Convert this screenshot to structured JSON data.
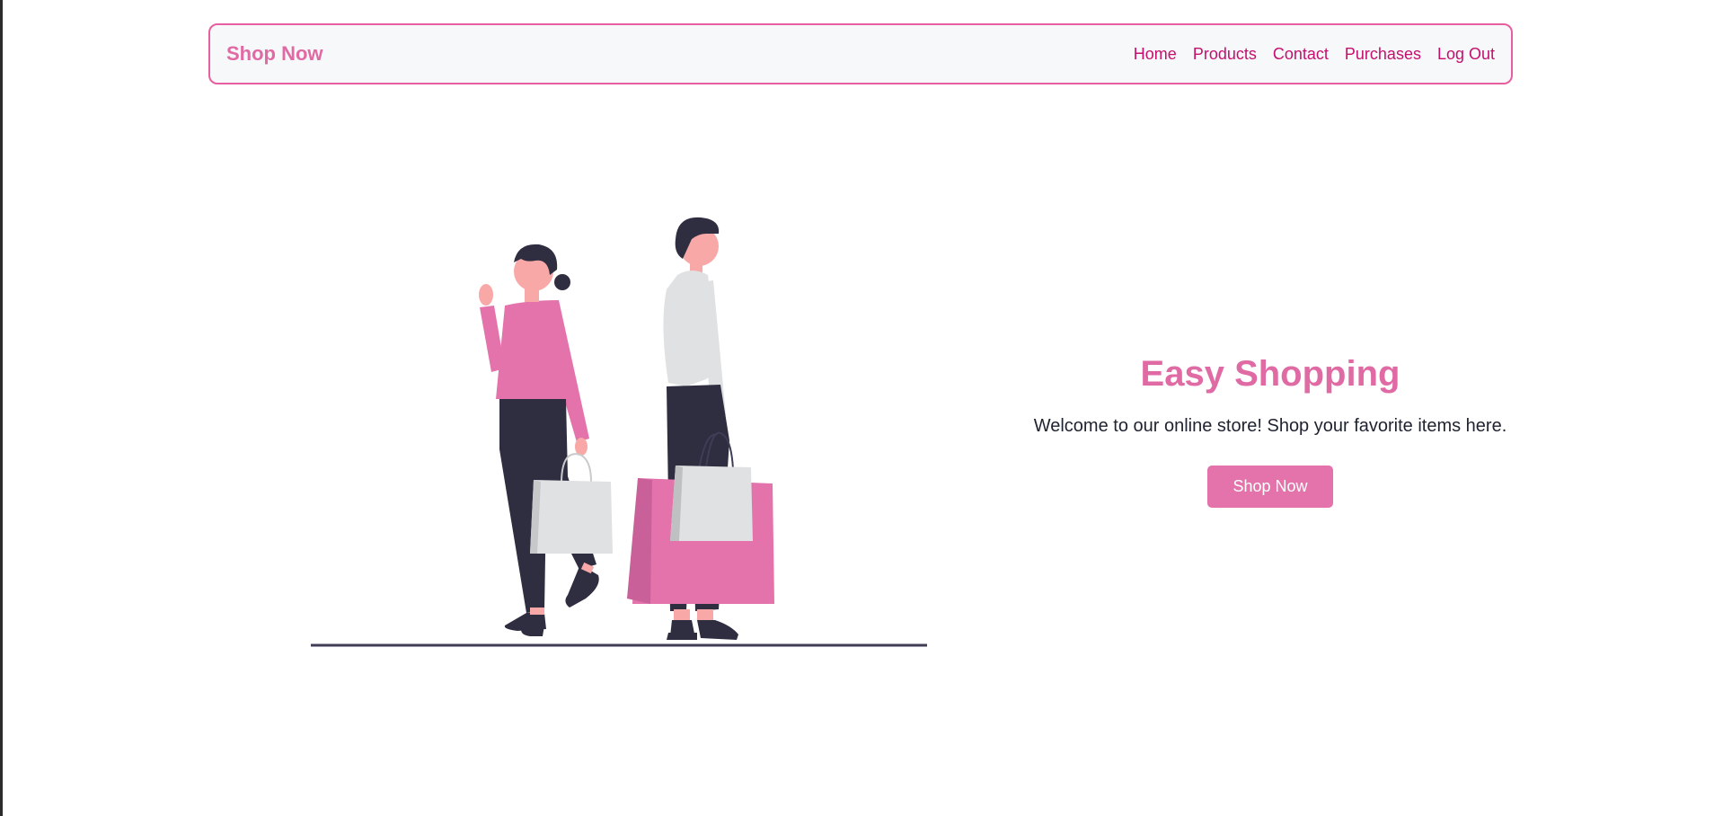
{
  "navbar": {
    "brand": "Shop Now",
    "links": [
      {
        "label": "Home"
      },
      {
        "label": "Products"
      },
      {
        "label": "Contact"
      },
      {
        "label": "Purchases"
      },
      {
        "label": "Log Out"
      }
    ]
  },
  "hero": {
    "title": "Easy Shopping",
    "subtitle": "Welcome to our online store! Shop your favorite items here.",
    "button_label": "Shop Now"
  },
  "colors": {
    "accent": "#e06aa4",
    "nav_link": "#c40f6e",
    "button": "#e373aa",
    "dark": "#2f2e41",
    "skin": "#f8a8a6",
    "light_gray": "#e0e1e3"
  },
  "illustration": {
    "description_icon": "shopping-couple-illustration"
  }
}
